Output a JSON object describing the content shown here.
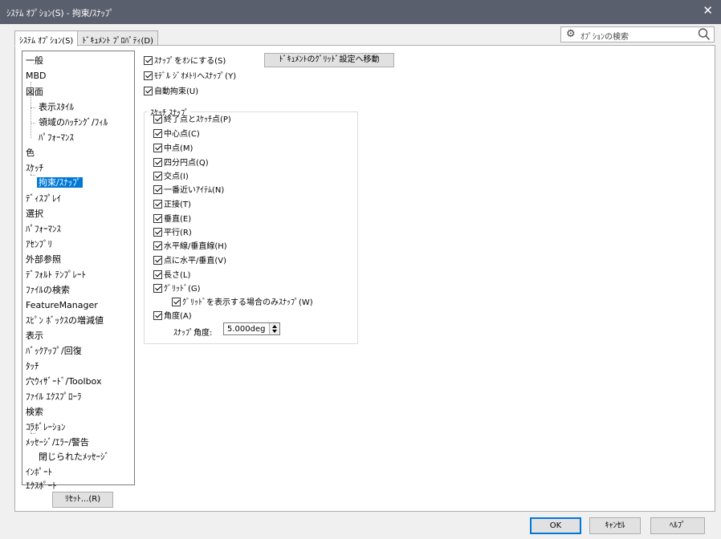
{
  "window": {
    "title": "ｼｽﾃﾑ ｵﾌﾟｼｮﾝ(S) - 拘束/ｽﾅｯﾌﾟ",
    "close_glyph": "✕"
  },
  "tabs": [
    {
      "label": "ｼｽﾃﾑ ｵﾌﾟｼｮﾝ(S)",
      "active": true
    },
    {
      "label": "ﾄﾞｷｭﾒﾝﾄ ﾌﾟﾛﾊﾟﾃｨ(D)",
      "active": false
    }
  ],
  "search": {
    "placeholder": "ｵﾌﾟｼｮﾝの検索",
    "icon": "search-icon",
    "gear_icon": "gear-icon"
  },
  "tree": [
    {
      "label": "一般"
    },
    {
      "label": "MBD"
    },
    {
      "label": "図面"
    },
    {
      "label": "表示ｽﾀｲﾙ"
    },
    {
      "label": "領域のﾊｯﾁﾝｸﾞ/ﾌｨﾙ"
    },
    {
      "label": "ﾊﾟﾌｫｰﾏﾝｽ"
    },
    {
      "label": "色"
    },
    {
      "label": "ｽｹｯﾁ"
    },
    {
      "label": "拘束/ｽﾅｯﾌﾟ",
      "selected": true
    },
    {
      "label": "ﾃﾞｨｽﾌﾟﾚｲ"
    },
    {
      "label": "選択"
    },
    {
      "label": "ﾊﾟﾌｫｰﾏﾝｽ"
    },
    {
      "label": "ｱｾﾝﾌﾞﾘ"
    },
    {
      "label": "外部参照"
    },
    {
      "label": "ﾃﾞﾌｫﾙﾄ ﾃﾝﾌﾟﾚｰﾄ"
    },
    {
      "label": "ﾌｧｲﾙの検索"
    },
    {
      "label": "FeatureManager"
    },
    {
      "label": "ｽﾋﾟﾝ ﾎﾞｯｸｽの増減値"
    },
    {
      "label": "表示"
    },
    {
      "label": "ﾊﾞｯｸｱｯﾌﾟ/回復"
    },
    {
      "label": "ﾀｯﾁ"
    },
    {
      "label": "穴ｳｨｻﾞｰﾄﾞ/Toolbox"
    },
    {
      "label": "ﾌｧｲﾙ ｴｸｽﾌﾟﾛｰﾗ"
    },
    {
      "label": "検索"
    },
    {
      "label": "ｺﾗﾎﾞﾚｰｼｮﾝ"
    },
    {
      "label": "ﾒｯｾｰｼﾞ/ｴﾗｰ/警告"
    },
    {
      "label": "閉じられたﾒｯｾｰｼﾞ"
    },
    {
      "label": "ｲﾝﾎﾟｰﾄ"
    },
    {
      "label": "ｴｸｽﾎﾟｰﾄ"
    }
  ],
  "reset_button": "ﾘｾｯﾄ...(R)",
  "options": [
    {
      "label": "ｽﾅｯﾌﾟをｵﾝにする(S)",
      "checked": true
    },
    {
      "label": "ﾓﾃﾞﾙ ｼﾞｵﾒﾄﾘへｽﾅｯﾌﾟ(Y)",
      "checked": true
    },
    {
      "label": "自動拘束(U)",
      "checked": true
    }
  ],
  "grid_settings_button": "ﾄﾞｷｭﾒﾝﾄのｸﾞﾘｯﾄﾞ設定へ移動",
  "sketch_snaps": {
    "group_label": "ｽｹｯﾁ ｽﾅｯﾌﾟ",
    "items": [
      {
        "label": "終了点とｽｹｯﾁ点(P)",
        "checked": true
      },
      {
        "label": "中心点(C)",
        "checked": true
      },
      {
        "label": "中点(M)",
        "checked": true
      },
      {
        "label": "四分円点(Q)",
        "checked": true
      },
      {
        "label": "交点(I)",
        "checked": true
      },
      {
        "label": "一番近いｱｲﾃﾑ(N)",
        "checked": true
      },
      {
        "label": "正接(T)",
        "checked": true
      },
      {
        "label": "垂直(E)",
        "checked": true
      },
      {
        "label": "平行(R)",
        "checked": true
      },
      {
        "label": "水平線/垂直線(H)",
        "checked": true
      },
      {
        "label": "点に水平/垂直(V)",
        "checked": true
      },
      {
        "label": "長さ(L)",
        "checked": true
      },
      {
        "label": "ｸﾞﾘｯﾄﾞ(G)",
        "checked": true
      },
      {
        "label": "ｸﾞﾘｯﾄﾞを表示する場合のみｽﾅｯﾌﾟ(W)",
        "checked": true
      },
      {
        "label": "角度(A)",
        "checked": true
      }
    ],
    "angle_label": "ｽﾅｯﾌﾟ角度:",
    "angle_value": "5.000deg"
  },
  "footer": {
    "ok": "OK",
    "cancel": "ｷｬﾝｾﾙ",
    "help": "ﾍﾙﾌﾟ"
  }
}
